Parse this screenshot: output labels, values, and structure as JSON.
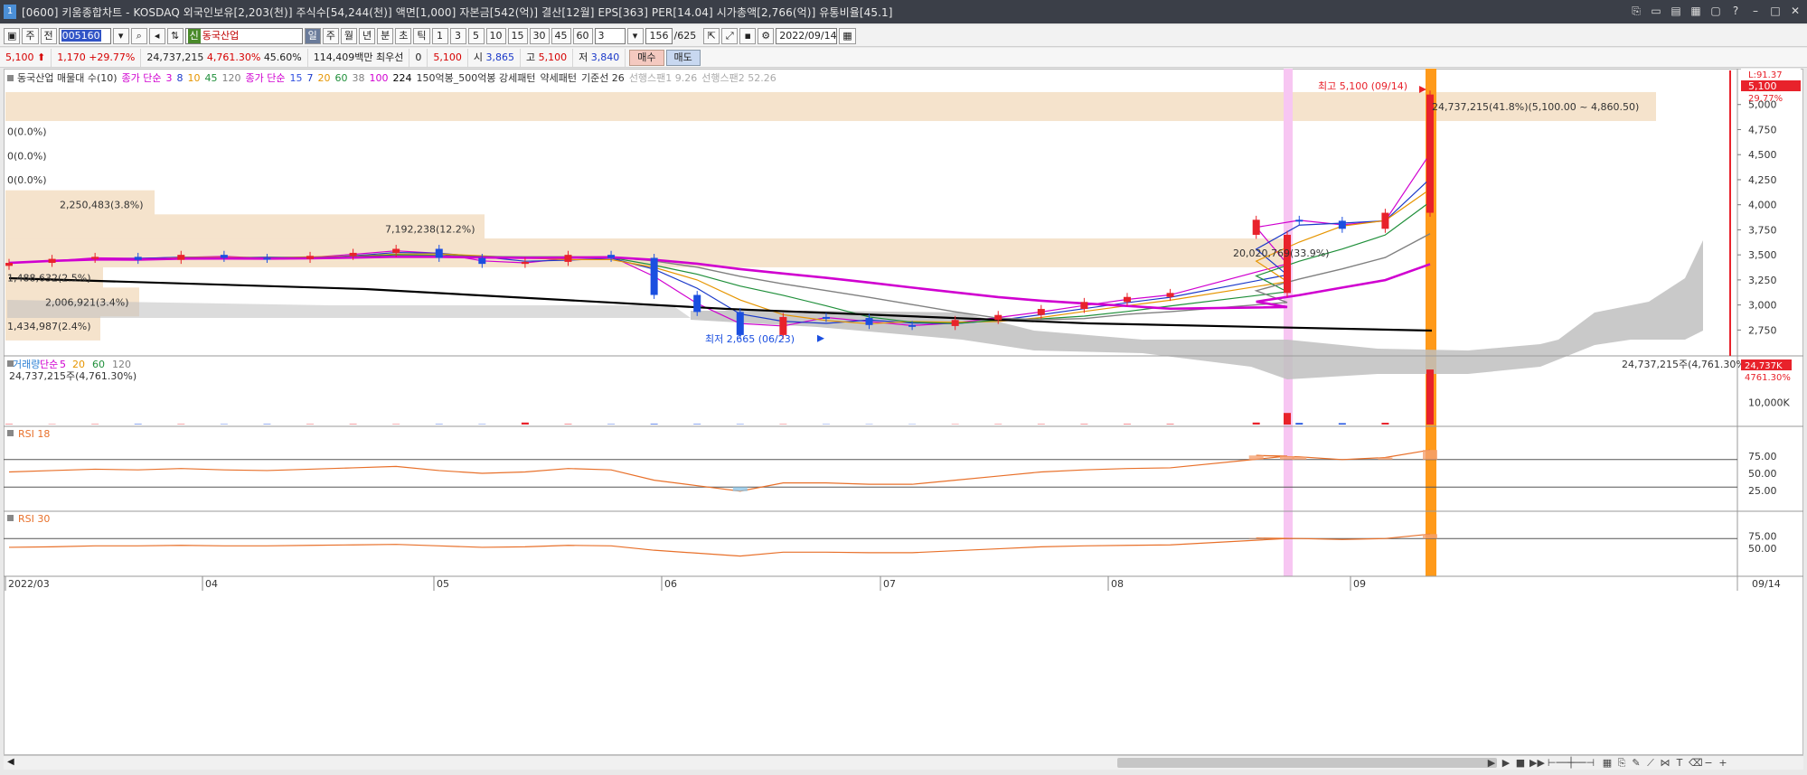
{
  "window": {
    "app_icon": "1",
    "title": "[0600] 키움종합차트 - KOSDAQ 외국인보유[2,203(천)] 주식수[54,244(천)] 액면[1,000] 자본금[542(억)] 결산[12월] EPS[363] PER[14.04] 시가총액[2,766(억)] 유통비율[45.1]",
    "controls": [
      "link-icon",
      "restore-group-icon",
      "layout-icon",
      "tile-icon",
      "lock-icon",
      "help-icon",
      "minimize-icon",
      "maximize-icon",
      "close-icon"
    ]
  },
  "toolbar": {
    "period_buttons_left": [
      "주",
      "전"
    ],
    "stock_code": "005160",
    "stock_badge": "신",
    "stock_name": "동국산업",
    "period_tabs": [
      "일",
      "주",
      "월",
      "년",
      "분",
      "초",
      "틱"
    ],
    "active_period": "일",
    "interval_buttons": [
      "1",
      "3",
      "5",
      "10",
      "15",
      "30",
      "45",
      "60"
    ],
    "interval_select": "3",
    "count": "156",
    "count_total": "/625",
    "date": "2022/09/14"
  },
  "quote": {
    "price": "5,100",
    "change": "1,170",
    "change_pct": "+29.77%",
    "volume": "24,737,215",
    "volume_pct": "4,761.30%",
    "turnover_pct": "45.60%",
    "amount": "114,409백만",
    "best_bid_label": "최우선",
    "best_bid_qty": "0",
    "best_bid_price": "5,100",
    "open_label": "시",
    "open": "3,865",
    "high_label": "고",
    "high": "5,100",
    "low_label": "저",
    "low": "3,840",
    "buy_label": "매수",
    "sell_label": "매도"
  },
  "price_pane": {
    "legend": [
      {
        "text": "동국산업 매물대 수(10)",
        "color": "#333333"
      },
      {
        "text": "종가 단순",
        "color": "#d000d0"
      },
      {
        "text": "3",
        "color": "#d000d0"
      },
      {
        "text": "8",
        "color": "#1b39c9"
      },
      {
        "text": "10",
        "color": "#e69500"
      },
      {
        "text": "45",
        "color": "#1f8f3a"
      },
      {
        "text": "120",
        "color": "#808080"
      },
      {
        "text": "종가 단순",
        "color": "#d000d0"
      },
      {
        "text": "15",
        "color": "#3050e0"
      },
      {
        "text": "7",
        "color": "#1b39c9"
      },
      {
        "text": "20",
        "color": "#e69500"
      },
      {
        "text": "60",
        "color": "#1f8f3a"
      },
      {
        "text": "38",
        "color": "#808080"
      },
      {
        "text": "100",
        "color": "#d000d0"
      },
      {
        "text": "224",
        "color": "#000000"
      },
      {
        "text": "150억봉_500억봉 강세패턴",
        "color": "#333333"
      },
      {
        "text": "약세패턴",
        "color": "#333333"
      },
      {
        "text": "기준선 26",
        "color": "#333333"
      },
      {
        "text": "선행스팬1 9.26",
        "color": "#aaaaaa"
      },
      {
        "text": "선행스팬2 52.26",
        "color": "#aaaaaa"
      }
    ],
    "y_ticks": [
      "5,000",
      "4,750",
      "4,500",
      "4,250",
      "4,000",
      "3,750",
      "3,500",
      "3,250",
      "3,000",
      "2,750"
    ],
    "ylim": [
      2600,
      5250
    ],
    "current_price_tag": "5,100",
    "change_tag": "29.77%",
    "top_right_tag": "L:91.37",
    "high_annotation": "최고 5,100 (09/14)",
    "low_annotation": "최저 2,665 (06/23)",
    "volume_profile_labels": [
      {
        "text": "24,737,215(41.8%)(5,100.00 ~ 4,860.50)",
        "price": 4980
      },
      {
        "text": "0(0.0%)",
        "price": 4730
      },
      {
        "text": "0(0.0%)",
        "price": 4490
      },
      {
        "text": "0(0.0%)",
        "price": 4250
      },
      {
        "text": "2,250,483(3.8%)",
        "price": 4000
      },
      {
        "text": "7,192,238(12.2%)",
        "price": 3760
      },
      {
        "text": "20,020,769(33.9%)",
        "price": 3520
      },
      {
        "text": "1,488,632(2.5%)",
        "price": 3270
      },
      {
        "text": "2,006,921(3.4%)",
        "price": 3030
      },
      {
        "text": "1,434,987(2.4%)",
        "price": 2790
      }
    ]
  },
  "volume_pane": {
    "legend": [
      {
        "text": "거래량",
        "color": "#2a7fd4"
      },
      {
        "text": "단순",
        "color": "#d000d0"
      },
      {
        "text": "5",
        "color": "#d000d0"
      },
      {
        "text": "20",
        "color": "#e69500"
      },
      {
        "text": "60",
        "color": "#1f8f3a"
      },
      {
        "text": "120",
        "color": "#808080"
      }
    ],
    "value_line": "24,737,215주(4,761.30%)",
    "right_value": "24,737,215주(4,761.30%)",
    "y_tick": "10,000K",
    "tag_value": "24,737K",
    "tag_pct": "4761.30%"
  },
  "rsi18_pane": {
    "label": "RSI 18",
    "y_ticks": [
      "75.00",
      "50.00",
      "25.00"
    ]
  },
  "rsi30_pane": {
    "label": "RSI 30",
    "y_ticks": [
      "75.00",
      "50.00"
    ]
  },
  "x_axis": {
    "labels": [
      "2022/03",
      "04",
      "05",
      "06",
      "07",
      "08",
      "09"
    ],
    "current_date_tag": "09/14"
  },
  "colors": {
    "up": "#e8222b",
    "down": "#1b4fe0",
    "highlight_pink": "#f7c6f2",
    "highlight_orange": "#ff9a1a",
    "profile_band": "#f5e3cc",
    "cloud": "#c0c0c0",
    "rsi_line": "#e8702a"
  },
  "chart_data": {
    "type": "candlestick",
    "x": [
      "03/02",
      "03/07",
      "03/14",
      "03/21",
      "03/28",
      "04/04",
      "04/11",
      "04/18",
      "04/25",
      "05/02",
      "05/09",
      "05/16",
      "05/23",
      "05/30",
      "06/07",
      "06/13",
      "06/20",
      "06/23",
      "06/27",
      "07/04",
      "07/11",
      "07/18",
      "07/25",
      "08/01",
      "08/08",
      "08/16",
      "08/22",
      "08/26",
      "08/29",
      "09/01",
      "09/05",
      "09/08",
      "09/13",
      "09/14"
    ],
    "close": [
      3420,
      3460,
      3480,
      3450,
      3500,
      3470,
      3460,
      3490,
      3520,
      3560,
      3470,
      3410,
      3430,
      3500,
      3470,
      3100,
      2930,
      2700,
      2880,
      2870,
      2800,
      2790,
      2850,
      2900,
      2960,
      3030,
      3080,
      3120,
      3700,
      3850,
      3840,
      3760,
      3920,
      5100
    ],
    "rsi18": [
      52,
      54,
      56,
      55,
      57,
      55,
      54,
      56,
      58,
      60,
      54,
      50,
      52,
      57,
      55,
      40,
      32,
      24,
      36,
      36,
      34,
      34,
      40,
      46,
      52,
      55,
      57,
      58,
      75,
      76,
      74,
      70,
      73,
      84
    ],
    "rsi30": [
      52,
      53,
      55,
      55,
      56,
      55,
      55,
      56,
      57,
      58,
      55,
      52,
      53,
      56,
      55,
      46,
      40,
      34,
      42,
      42,
      41,
      41,
      45,
      49,
      53,
      55,
      56,
      57,
      70,
      71,
      70,
      68,
      70,
      79
    ],
    "volume_k": [
      180,
      120,
      150,
      200,
      160,
      140,
      180,
      150,
      170,
      140,
      160,
      130,
      900,
      200,
      160,
      260,
      200,
      150,
      140,
      120,
      110,
      100,
      120,
      140,
      160,
      180,
      200,
      220,
      5200,
      900,
      700,
      600,
      800,
      24737
    ]
  }
}
